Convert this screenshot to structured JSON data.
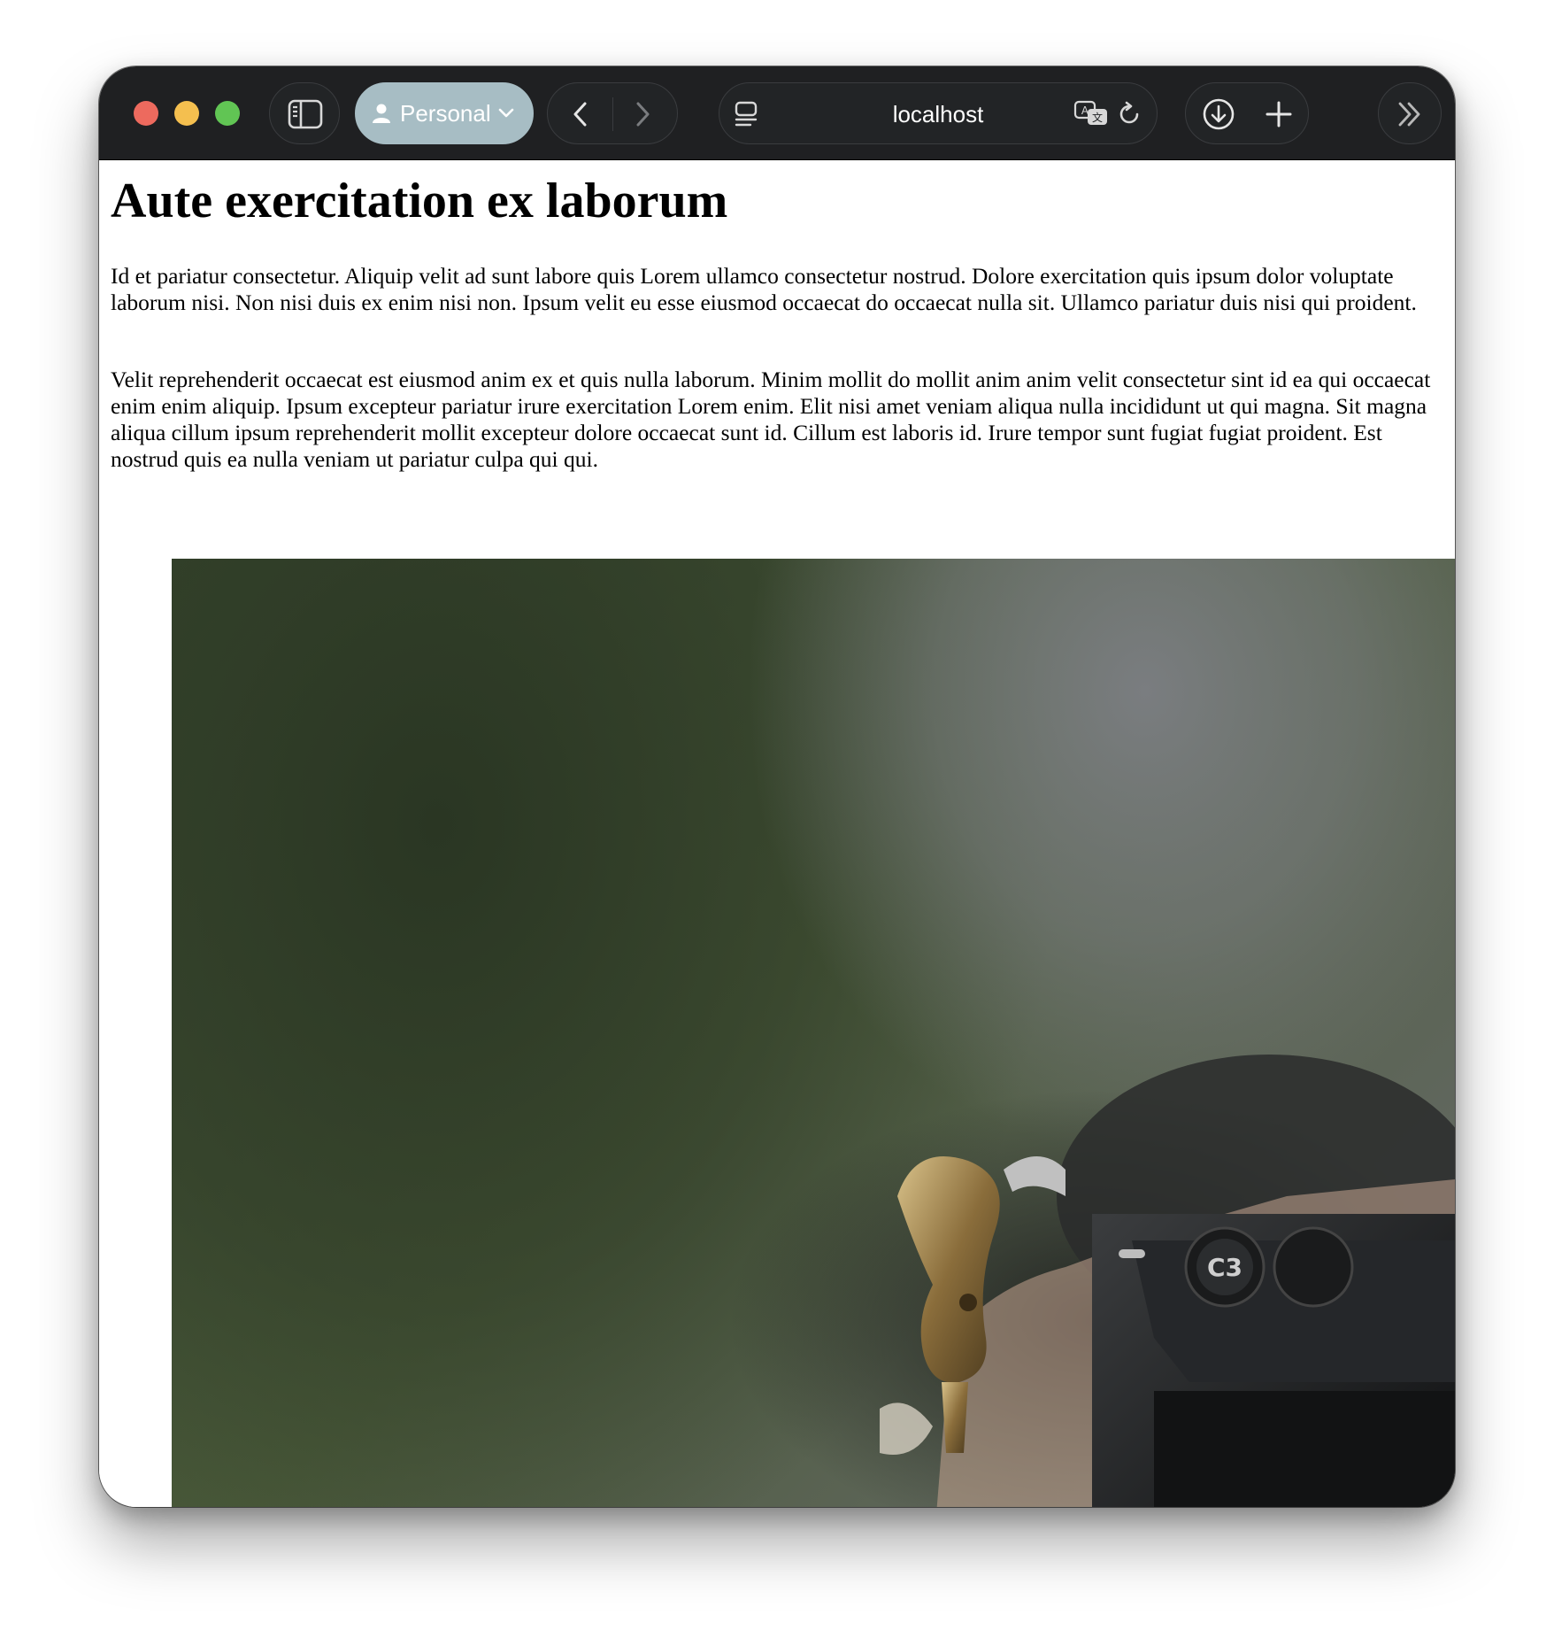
{
  "browser": {
    "profile_label": "Personal",
    "address": "localhost",
    "icons": {
      "sidebar": "sidebar-icon",
      "profile": "person-icon",
      "profile_menu": "chevron-down-icon",
      "back": "chevron-left-icon",
      "forward": "chevron-right-icon",
      "page": "page-menu-icon",
      "translate": "translate-icon",
      "reload": "reload-icon",
      "download": "download-icon",
      "new_tab": "plus-icon",
      "overflow": "double-chevron-right-icon"
    },
    "colors": {
      "toolbar": "#1f2022",
      "profile_pill": "#a7bdc4",
      "close": "#ed6a5e",
      "minimize": "#f4bf4f",
      "zoom": "#61c554"
    }
  },
  "page": {
    "heading": "Aute exercitation ex laborum",
    "paragraphs": [
      "Id et pariatur consectetur. Aliquip velit ad sunt labore quis Lorem ullamco consectetur nostrud. Dolore exercitation quis ipsum dolor voluptate laborum nisi. Non nisi duis ex enim nisi non. Ipsum velit eu esse eiusmod occaecat do occaecat nulla sit. Ullamco pariatur duis nisi qui proident.",
      "Velit reprehenderit occaecat est eiusmod anim ex et quis nulla laborum. Minim mollit do mollit anim anim velit consectetur sint id ea qui occaecat enim enim aliquip. Ipsum excepteur pariatur irure exercitation Lorem enim. Elit nisi amet veniam aliqua nulla incididunt ut qui magna. Sit magna aliqua cillum ipsum reprehenderit mollit excepteur dolore occaecat sunt id. Cillum est laboris id. Irure tempor sunt fugiat fugiat proident. Est nostrud quis ea nulla veniam ut pariatur culpa qui qui."
    ],
    "photo": {
      "camera_button_label": "C3"
    }
  }
}
